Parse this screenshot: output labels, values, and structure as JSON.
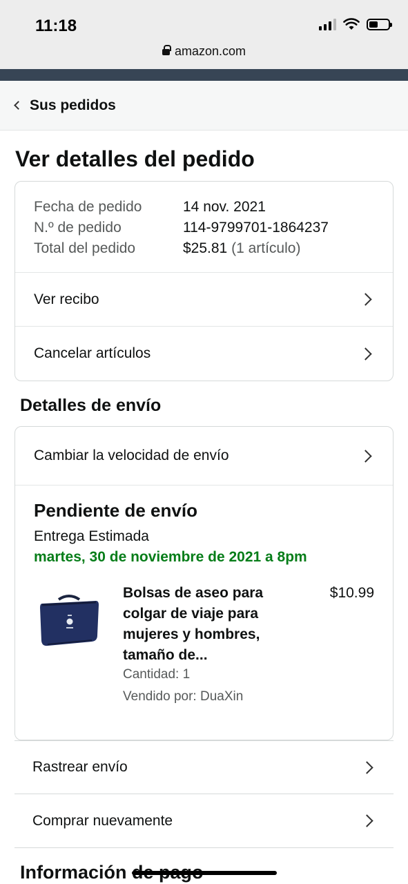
{
  "status_bar": {
    "time": "11:18",
    "battery_level": 0.45
  },
  "browser": {
    "url": "amazon.com"
  },
  "breadcrumb": {
    "label": "Sus pedidos"
  },
  "page": {
    "title": "Ver detalles del pedido"
  },
  "order_summary": {
    "rows": [
      {
        "key": "Fecha de pedido",
        "value": "14 nov. 2021",
        "extra": ""
      },
      {
        "key": "N.º de pedido",
        "value": "114-9799701-1864237",
        "extra": ""
      },
      {
        "key": "Total del pedido",
        "value": "$25.81",
        "extra": "(1 artículo)"
      }
    ],
    "links": [
      {
        "label": "Ver recibo"
      },
      {
        "label": "Cancelar artículos"
      }
    ]
  },
  "shipping": {
    "section_title": "Detalles de envío",
    "change_speed_label": "Cambiar la velocidad de envío",
    "status_title": "Pendiente de envío",
    "eta_label": "Entrega Estimada",
    "eta_date": "martes, 30 de noviembre de 2021 a 8pm",
    "eta_color": "#067d19",
    "item": {
      "name": "Bolsas de aseo para colgar de viaje para mujeres y hombres, tamaño de...",
      "price": "$10.99",
      "quantity": "Cantidad: 1",
      "seller": "Vendido por: DuaXin"
    }
  },
  "actions": [
    {
      "label": "Rastrear envío"
    },
    {
      "label": "Comprar nuevamente"
    }
  ],
  "payment": {
    "section_title": "Información de pago"
  }
}
